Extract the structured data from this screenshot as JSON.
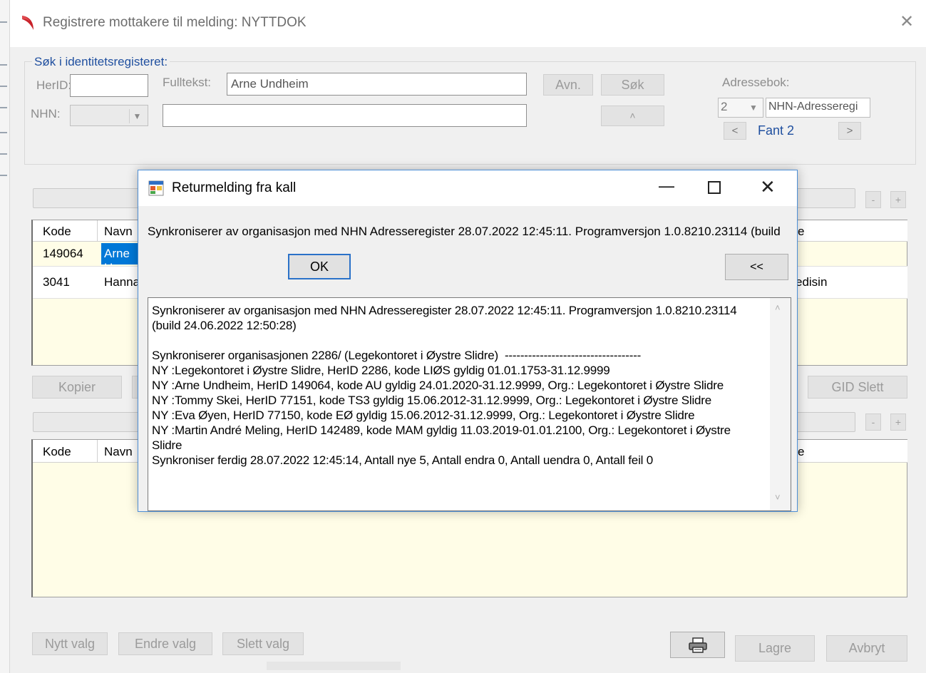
{
  "window": {
    "title": "Registrere mottakere til melding: NYTTDOK",
    "close_glyph": "✕"
  },
  "search": {
    "legend": "Søk i identitetsregisteret:",
    "herid_label": "HerID:",
    "herid_value": "",
    "nhn_label": "NHN:",
    "nhn_value": "",
    "fulltekst_label": "Fulltekst:",
    "fulltekst_value": "Arne Undheim",
    "second_field_value": "",
    "avn_button": "Avn.",
    "sok_button": "Søk",
    "small_button": "˄",
    "adressebok_label": "Adressebok:",
    "adressebok_number": "2",
    "adressebok_name": "NHN-Adresseregi",
    "prev_button": "<",
    "next_button": ">",
    "result_count": "Fant 2"
  },
  "top_grid": {
    "columns": [
      "Kode",
      "Navn"
    ],
    "rows": [
      {
        "kode": "149064",
        "navn": "Arne U",
        "right": ""
      },
      {
        "kode": "3041",
        "navn": "Hanna",
        "right": "edisin"
      }
    ],
    "right_header_fragment": "e"
  },
  "mid_buttons": {
    "kopier": "Kopier",
    "gid_slett": "GID Slett"
  },
  "bottom_grid": {
    "columns": [
      "Kode",
      "Navn"
    ],
    "right_header_fragment": "e"
  },
  "footer": {
    "nytt_valg": "Nytt valg",
    "endre_valg": "Endre valg",
    "slett_valg": "Slett valg",
    "lagre": "Lagre",
    "avbryt": "Avbryt"
  },
  "small_buttons": {
    "minus": "-",
    "plus": "+"
  },
  "dialog": {
    "title": "Returmelding fra kall",
    "minimize_glyph": "—",
    "close_glyph": "✕",
    "summary": "Synkroniserer av organisasjon med NHN Adresseregister 28.07.2022 12:45:11. Programversjon 1.0.8210.23114 (build",
    "ok_label": "OK",
    "expand_label": "<<",
    "log_text": "Synkroniserer av organisasjon med NHN Adresseregister 28.07.2022 12:45:11. Programversjon 1.0.8210.23114\n(build 24.06.2022 12:50:28)\n\nSynkroniserer organisasjonen 2286/ (Legekontoret i Øystre Slidre)  -----------------------------------\nNY :Legekontoret i Øystre Slidre, HerID 2286, kode LIØS gyldig 01.01.1753-31.12.9999\nNY :Arne Undheim, HerID 149064, kode AU gyldig 24.01.2020-31.12.9999, Org.: Legekontoret i Øystre Slidre\nNY :Tommy Skei, HerID 77151, kode TS3 gyldig 15.06.2012-31.12.9999, Org.: Legekontoret i Øystre Slidre\nNY :Eva Øyen, HerID 77150, kode EØ gyldig 15.06.2012-31.12.9999, Org.: Legekontoret i Øystre Slidre\nNY :Martin André Meling, HerID 142489, kode MAM gyldig 11.03.2019-01.01.2100, Org.: Legekontoret i Øystre\nSlidre\nSynkroniser ferdig 28.07.2022 12:45:14, Antall nye 5, Antall endra 0, Antall uendra 0, Antall feil 0"
  },
  "colors": {
    "selection": "#0078d7",
    "grid_background": "#fffde7",
    "dialog_border": "#4e8fd6",
    "link_blue": "#1f4f9f"
  }
}
